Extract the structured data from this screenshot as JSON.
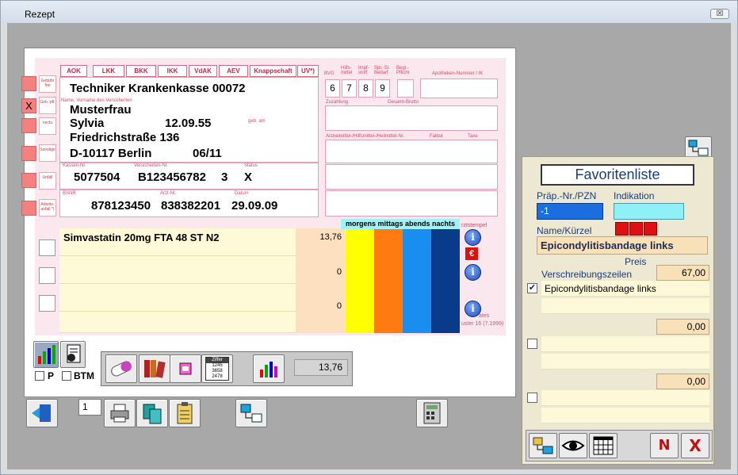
{
  "window": {
    "title": "Rezept",
    "close_glyph": "☒"
  },
  "form": {
    "kassen_tabs": [
      "AOK",
      "LKK",
      "BKK",
      "IKK",
      "VdAK",
      "AEV",
      "Knappschaft",
      "UV*)"
    ],
    "side_labels": [
      "Gebühr frei",
      "Geb.-pfl.",
      "noctu",
      "Sonstige",
      "Unfall",
      "Arbeits-unfall *)"
    ],
    "geb_pfl_mark": "X",
    "krankenkasse": "Techniker Krankenkasse   00072",
    "name_label": "Name, Vorname des Versicherten",
    "nachname": "Musterfrau",
    "vorname": "Sylvia",
    "geburtsdatum": "12.09.55",
    "geb_am_label": "geb. am",
    "strasse": "Friedrichstraße 136",
    "ort": "D-10117 Berlin",
    "gueltig": "06/11",
    "kassen_nr_label": "Kassen-Nr.",
    "versicherten_nr_label": "Versicherten-Nr.",
    "status_label": "Status",
    "kassen_nr": "5077504",
    "versicherten_nr": "B123456782",
    "status_num": "3",
    "status_x": "X",
    "bsnr_label": "BSNR",
    "arzt_nr_label": "Arzt-Nr.",
    "datum_label": "Datum",
    "bsnr": "878123450",
    "arzt_nr": "838382201",
    "datum": "29.09.09",
    "top_labels": {
      "bvg": "BVG",
      "hilfsmittel": "Hilfs-mittel",
      "impfstoff": "Impf-stoff",
      "bedarf": "Spr.-St. Bedarf",
      "pflicht": "Begr.-Pflicht",
      "apotheken": "Apotheken-Nummer / IK"
    },
    "number_boxes": [
      "6",
      "7",
      "8",
      "9"
    ],
    "zuzahlung_label": "Zuzahlung",
    "gesamt_label": "Gesamt-Brutto",
    "arzneimittel_label": "Arzneimittel-/Hilfsmittel-/Heilmittel-Nr.",
    "faktor_label": "Faktor",
    "taxe_label": "Taxe",
    "dosage_header": "morgens mittags abends nachts",
    "arztstempel_label": "rztstempel",
    "form_footer_1": "uster 16 (7.1999)",
    "form_footer_2": "ates"
  },
  "medications": [
    {
      "name": "Simvastatin 20mg FTA 48 ST N2",
      "price": "13,76"
    },
    {
      "name": "",
      "price": "0"
    },
    {
      "name": "",
      "price": "0"
    }
  ],
  "dosage_colors": [
    "#ffff00",
    "#ff7a10",
    "#1a8ef0",
    "#0a3a8a"
  ],
  "euro_glyph": "€",
  "info_glyph": "i",
  "toolbar": {
    "p_label": "P",
    "btm_label": "BTM",
    "copies": "1",
    "total": "13,76",
    "ziffer_label": "Ziffer",
    "ziffer_values": [
      "1245",
      "3658",
      "2478"
    ]
  },
  "favoriten": {
    "title": "Favoritenliste",
    "praep_label": "Präp.-Nr./PZN",
    "indikation_label": "Indikation",
    "praep_value": "-1",
    "name_label": "Name/Kürzel",
    "name_value": "Epicondylitisbandage links",
    "preis_label": "Preis",
    "verschreibung_label": "Verschreibungszeilen",
    "preis_value": "67,00",
    "line1": "Epicondylitisbandage links",
    "value2": "0,00",
    "value3": "0,00",
    "check_glyph": "✔",
    "n_label": "N",
    "x_label": "X"
  }
}
